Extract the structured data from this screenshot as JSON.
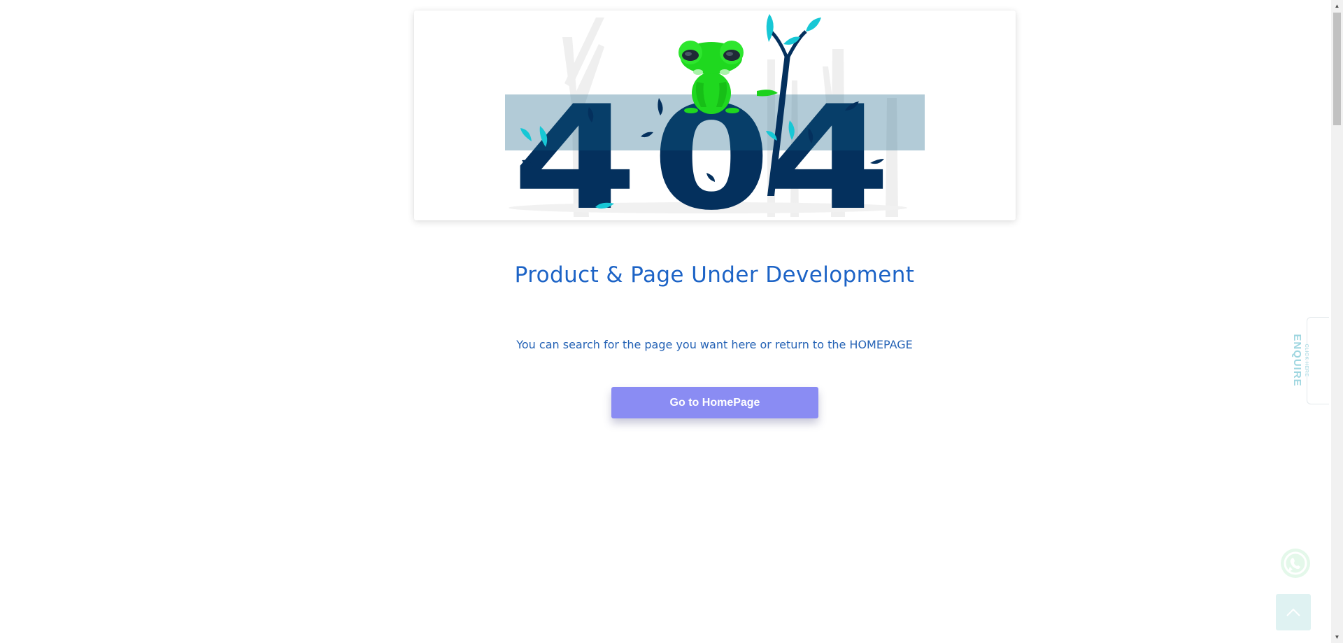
{
  "main": {
    "title": "Product & Page Under Development",
    "hint": "You can search for the page you want here or return to the HOMEPAGE",
    "button_label": "Go to HomePage",
    "illustration_number": "404"
  },
  "enquire_tab": {
    "small_label": "CLICK HERE",
    "label": "ENQUIRE"
  },
  "floating_buttons": {
    "whatsapp_icon": "whatsapp-icon",
    "back_to_top_icon": "chevron-up-icon"
  },
  "colors": {
    "title": "#1c63c6",
    "button": "#8a8cf3",
    "digits_dark": "#042d5b",
    "digits_light": "#0b4a70",
    "leaf_accent": "#16c8d7",
    "mascot": "#1fd81f"
  }
}
